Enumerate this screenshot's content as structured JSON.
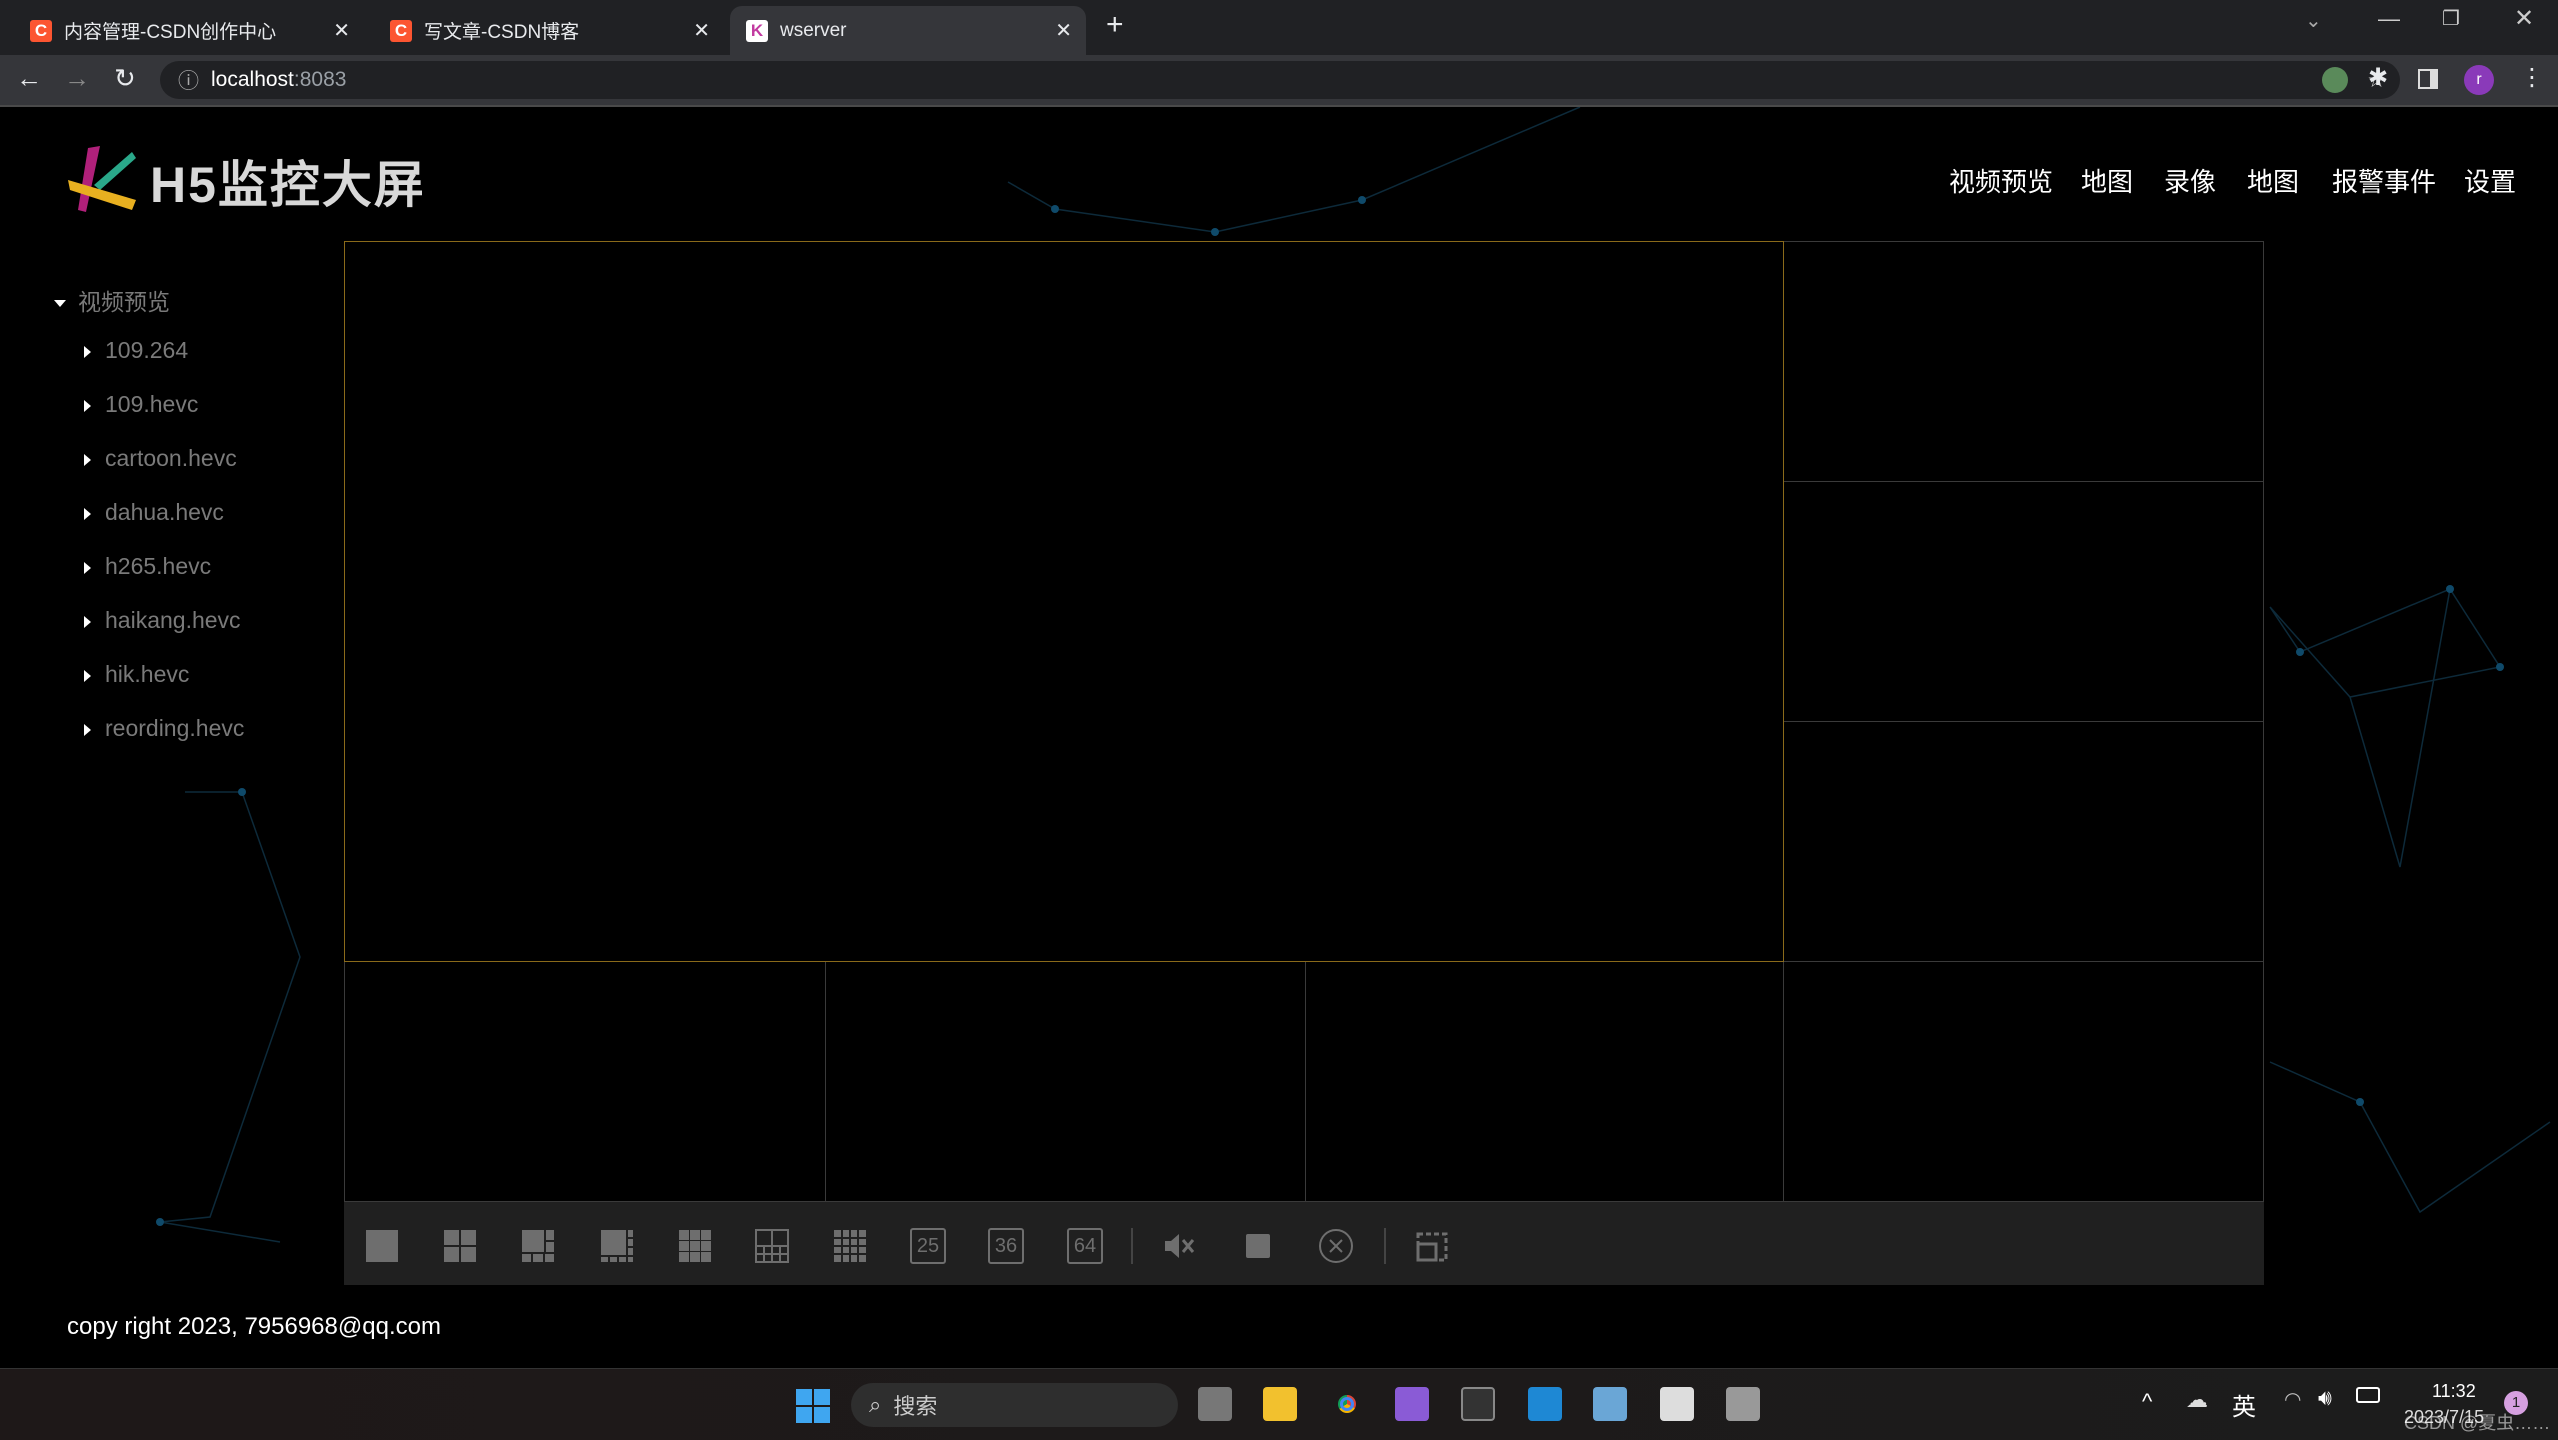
{
  "browser": {
    "tabs": [
      {
        "title": "内容管理-CSDN创作中心",
        "icon": "csdn-icon"
      },
      {
        "title": "写文章-CSDN博客",
        "icon": "csdn-icon"
      },
      {
        "title": "wserver",
        "icon": "k-logo-icon",
        "active": true
      }
    ],
    "url_host": "localhost",
    "url_port": ":8083"
  },
  "header": {
    "logo_text": "H5监控大屏",
    "nav": [
      "视频预览",
      "地图",
      "录像",
      "地图",
      "报警事件",
      "设置"
    ]
  },
  "sidebar": {
    "root": "视频预览",
    "items": [
      "109.264",
      "109.hevc",
      "cartoon.hevc",
      "dahua.hevc",
      "h265.hevc",
      "haikang.hevc",
      "hik.hevc",
      "reording.hevc"
    ]
  },
  "toolbar": {
    "buttons": [
      "layout-1-icon",
      "layout-4-icon",
      "layout-6-icon",
      "layout-8-icon",
      "layout-9-icon",
      "layout-13-icon",
      "layout-16-icon",
      "layout-25-icon",
      "layout-36-icon",
      "layout-64-icon",
      "mute-icon",
      "stop-icon",
      "close-all-icon",
      "fullscreen-icon"
    ],
    "labels": {
      "l25": "25",
      "l36": "36",
      "l64": "64"
    }
  },
  "footer": {
    "text": "copy right 2023, 7956968@qq.com"
  },
  "taskbar": {
    "search_placeholder": "搜索",
    "ime": "英",
    "time": "11:32",
    "date": "2023/7/15",
    "notifications": "1",
    "watermark": "CSDN @夏虫……"
  },
  "colors": {
    "active_cell_border": "#8a6a1a",
    "cell_border": "#3a3a3a",
    "toolbar_bg": "#202020",
    "icon_gray": "#6e6e6e"
  }
}
